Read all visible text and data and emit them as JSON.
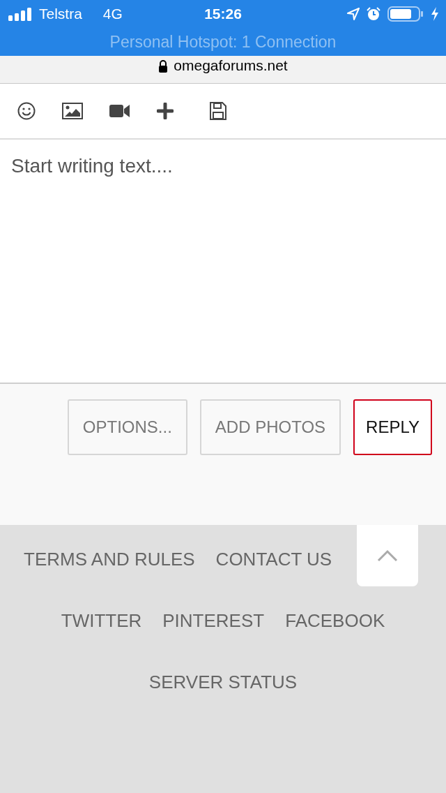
{
  "status_bar": {
    "carrier": "Telstra",
    "network": "4G",
    "time": "15:26"
  },
  "hotspot_banner": "Personal Hotspot: 1 Connection",
  "address_bar": {
    "domain": "omegaforums.net"
  },
  "editor": {
    "placeholder": "Start writing text...."
  },
  "buttons": [
    {
      "label": "OPTIONS...",
      "kind": "secondary"
    },
    {
      "label": "ADD PHOTOS",
      "kind": "secondary"
    },
    {
      "label": "REPLY",
      "kind": "primary"
    }
  ],
  "footer_links": [
    [
      "TERMS AND RULES",
      "CONTACT US"
    ],
    [
      "TWITTER",
      "PINTEREST",
      "FACEBOOK"
    ],
    [
      "SERVER STATUS"
    ]
  ]
}
